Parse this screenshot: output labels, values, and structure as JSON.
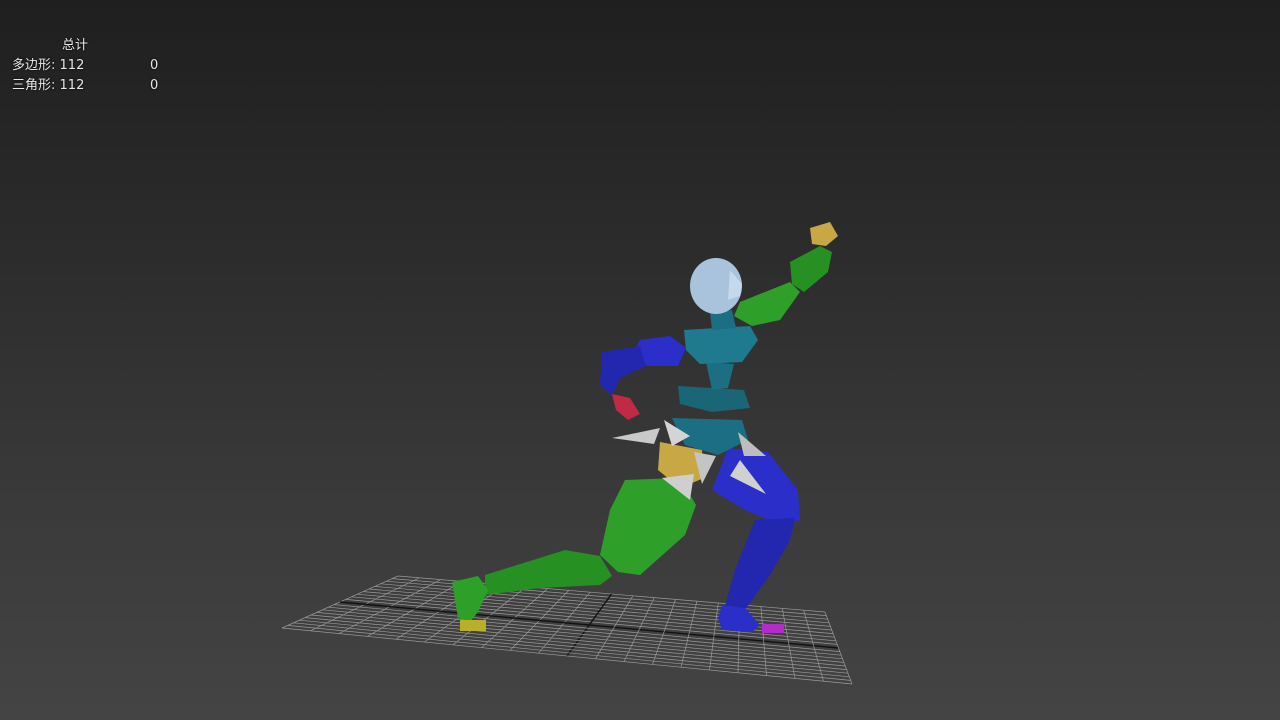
{
  "viewport": {
    "stats": {
      "header": "总计",
      "polygons": {
        "label": "多边形:",
        "total": "112",
        "selected": "0"
      },
      "triangles": {
        "label": "三角形:",
        "total": "112",
        "selected": "0"
      }
    }
  },
  "colors": {
    "background_top": "#1f1f1f",
    "background_bottom": "#444444",
    "grid": "#9a9a9a",
    "biped_green": "#2ea02a",
    "biped_blue": "#2b2ec9",
    "biped_teal": "#1c6e82",
    "head": "#a9c3dd",
    "spikes": "#c9c9c9",
    "pelvis": "#c8a845"
  }
}
